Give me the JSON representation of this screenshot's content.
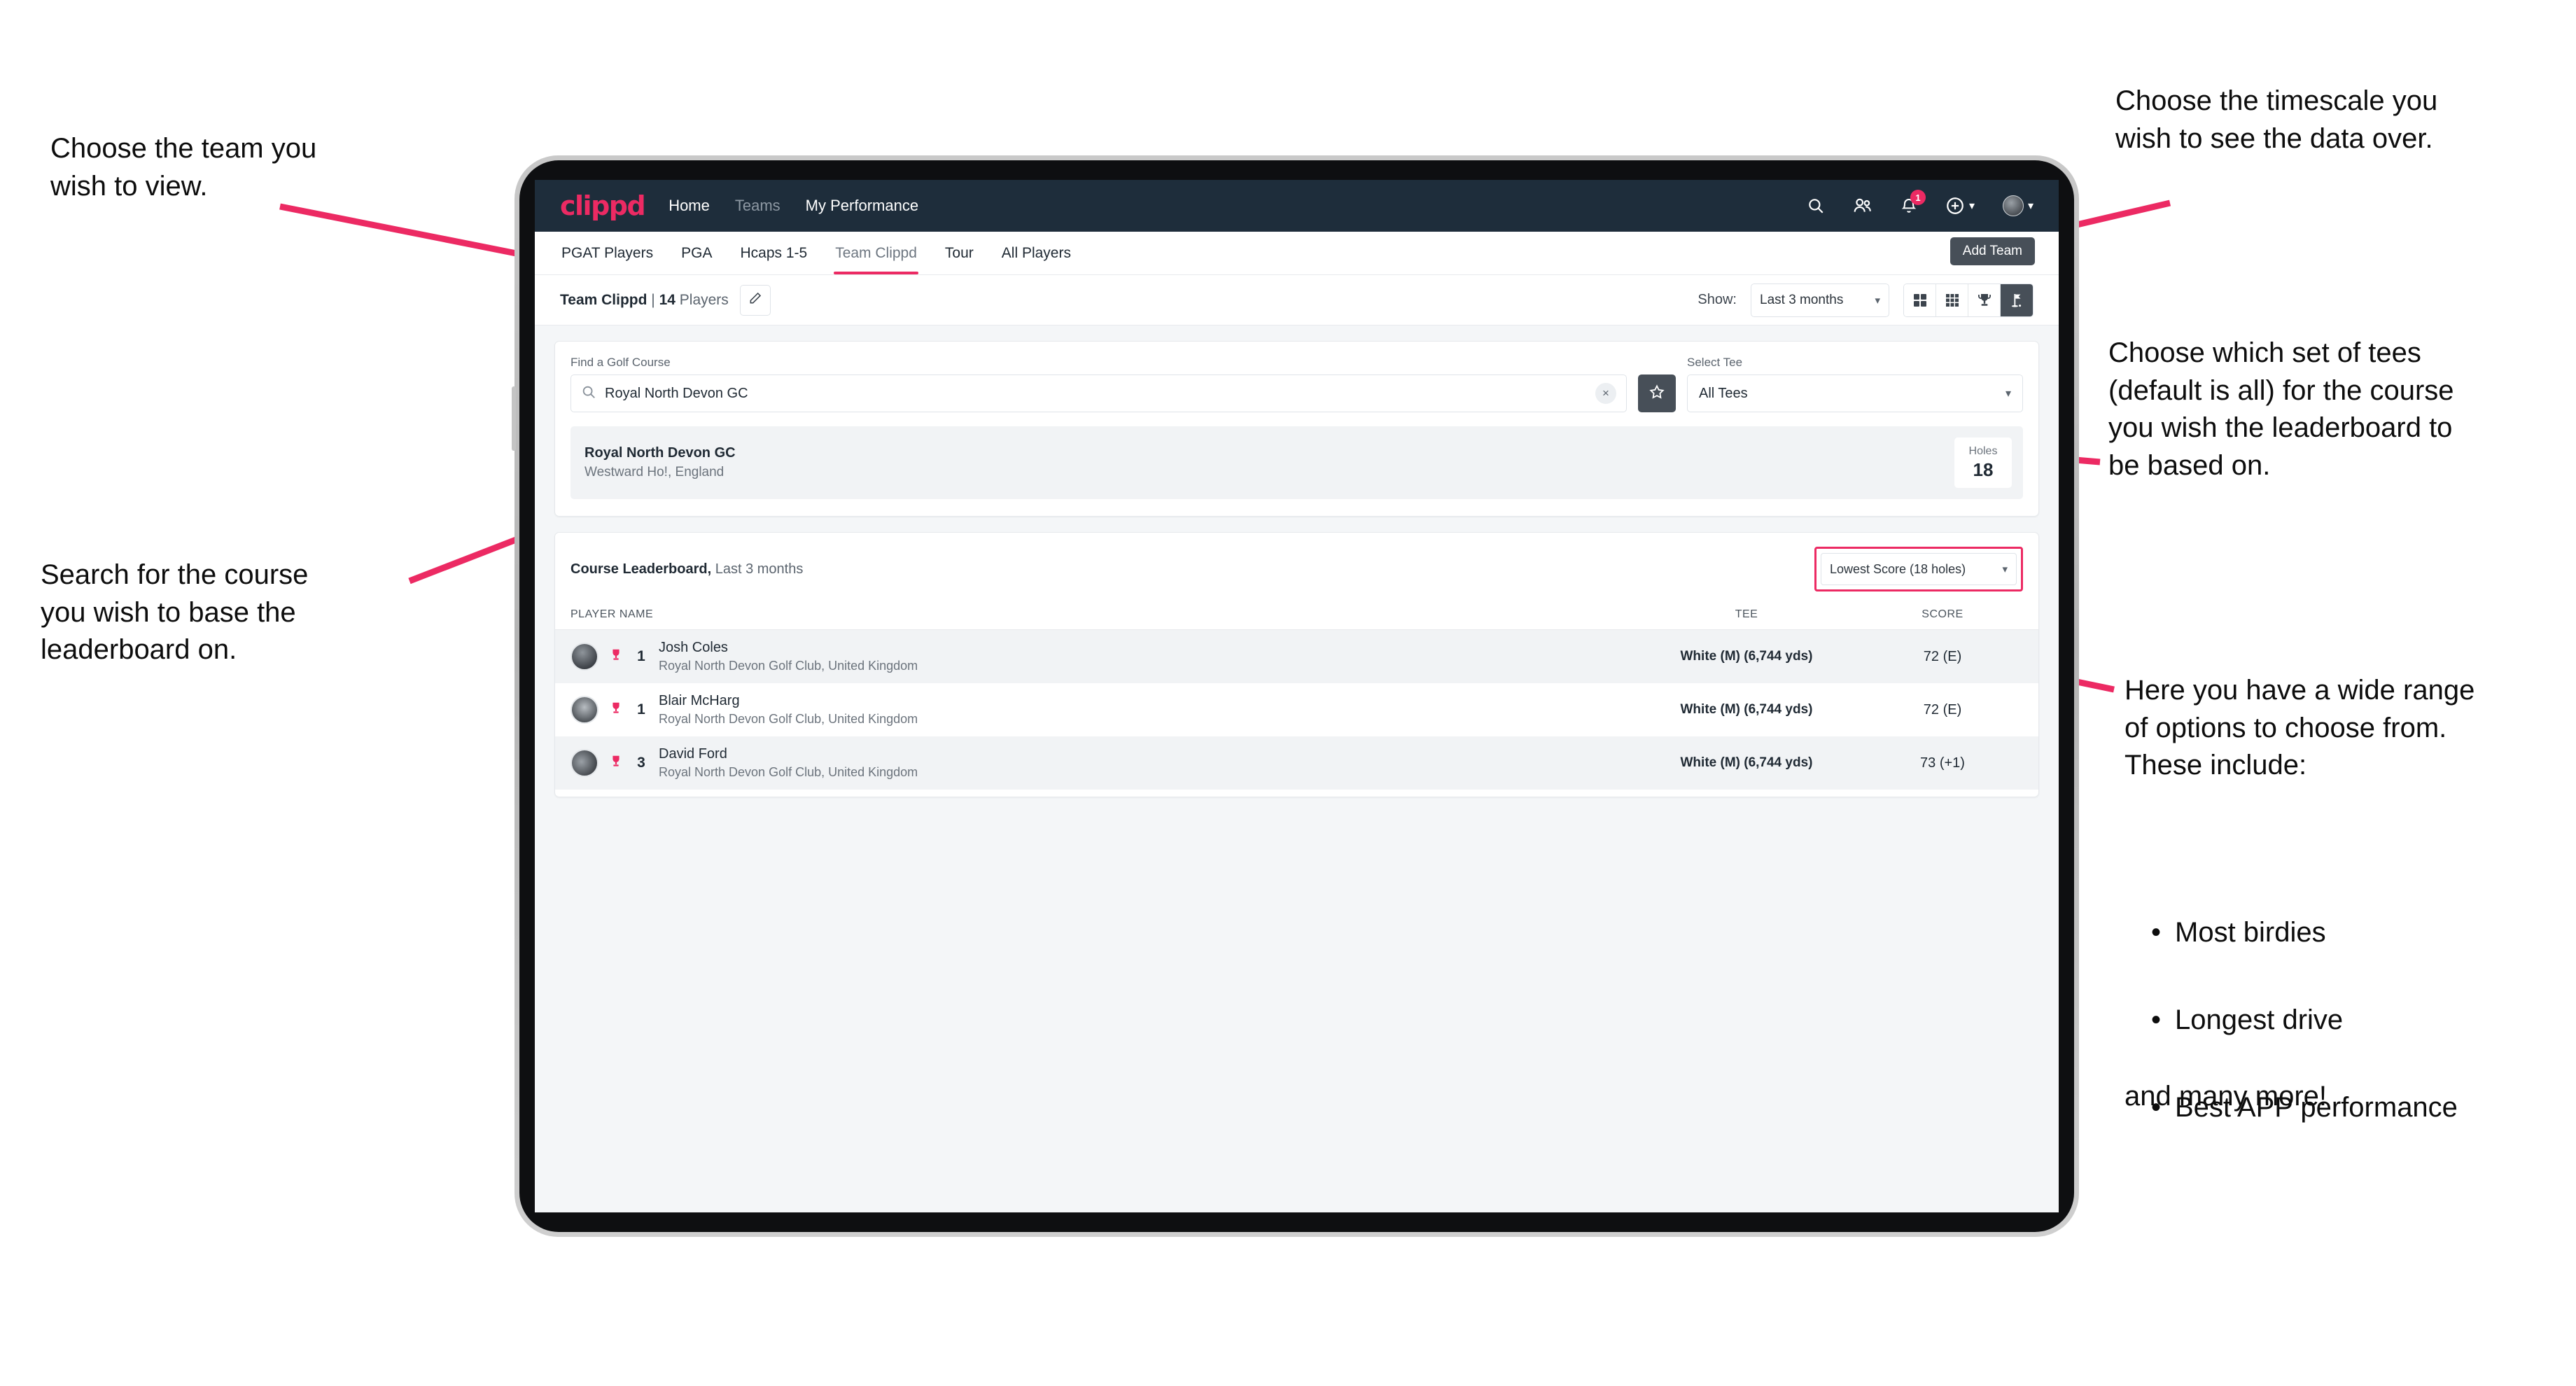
{
  "annotations": {
    "team": "Choose the team you\nwish to view.",
    "search": "Search for the course\nyou wish to base the\nleaderboard on.",
    "timescale": "Choose the timescale you\nwish to see the data over.",
    "tees": "Choose which set of tees\n(default is all) for the course\nyou wish the leaderboard to\nbe based on.",
    "options_intro": "Here you have a wide range\nof options to choose from.\nThese include:",
    "options_list": [
      "Most birdies",
      "Longest drive",
      "Best APP performance"
    ],
    "options_outro": "and many more!"
  },
  "app": {
    "navbar": {
      "logo": "clippd",
      "links": [
        {
          "label": "Home",
          "active": true
        },
        {
          "label": "Teams",
          "active": false
        },
        {
          "label": "My Performance",
          "active": true
        }
      ],
      "icons": [
        "search-icon",
        "people-icon",
        "bell-icon",
        "plus-circle-icon",
        "avatar"
      ],
      "notification_count": "1"
    },
    "tabs": [
      {
        "label": "PGAT Players",
        "active": false
      },
      {
        "label": "PGA",
        "active": false
      },
      {
        "label": "Hcaps 1-5",
        "active": false
      },
      {
        "label": "Team Clippd",
        "active": true
      },
      {
        "label": "Tour",
        "active": false
      },
      {
        "label": "All Players",
        "active": false
      }
    ],
    "add_team_tooltip": "Add Team",
    "toolbar": {
      "team_name": "Team Clippd",
      "separator": " | ",
      "player_count": "14",
      "players_word": " Players",
      "edit_icon": "pencil-icon",
      "show_label": "Show:",
      "timescale_value": "Last 3 months",
      "views": [
        {
          "name": "grid-2x2-view",
          "active": false
        },
        {
          "name": "grid-3x3-view",
          "active": false
        },
        {
          "name": "trophy-view",
          "active": false
        },
        {
          "name": "golf-flag-view",
          "active": true
        }
      ]
    },
    "search_panel": {
      "course_label": "Find a Golf Course",
      "course_value": "Royal North Devon GC",
      "course_placeholder": "Find a Golf Course",
      "clear_label": "×",
      "favourite_icon": "star-icon",
      "tee_label": "Select Tee",
      "tee_value": "All Tees"
    },
    "course_result": {
      "name": "Royal North Devon GC",
      "location": "Westward Ho!, England",
      "holes_label": "Holes",
      "holes_value": "18"
    },
    "leaderboard": {
      "title": "Course Leaderboard,",
      "subtitle": " Last 3 months",
      "sort_value": "Lowest Score (18 holes)",
      "columns": {
        "name": "PLAYER NAME",
        "tee": "TEE",
        "score": "SCORE"
      },
      "rows": [
        {
          "rank": "1",
          "name": "Josh Coles",
          "club": "Royal North Devon Golf Club, United Kingdom",
          "tee": "White (M) (6,744 yds)",
          "score": "72 (E)"
        },
        {
          "rank": "1",
          "name": "Blair McHarg",
          "club": "Royal North Devon Golf Club, United Kingdom",
          "tee": "White (M) (6,744 yds)",
          "score": "72 (E)"
        },
        {
          "rank": "3",
          "name": "David Ford",
          "club": "Royal North Devon Golf Club, United Kingdom",
          "tee": "White (M) (6,744 yds)",
          "score": "73 (+1)"
        }
      ]
    }
  },
  "colors": {
    "accent": "#ec2a63",
    "navbar": "#1e2d3b",
    "dark_ui": "#474f58",
    "page_bg": "#f4f6f8"
  }
}
